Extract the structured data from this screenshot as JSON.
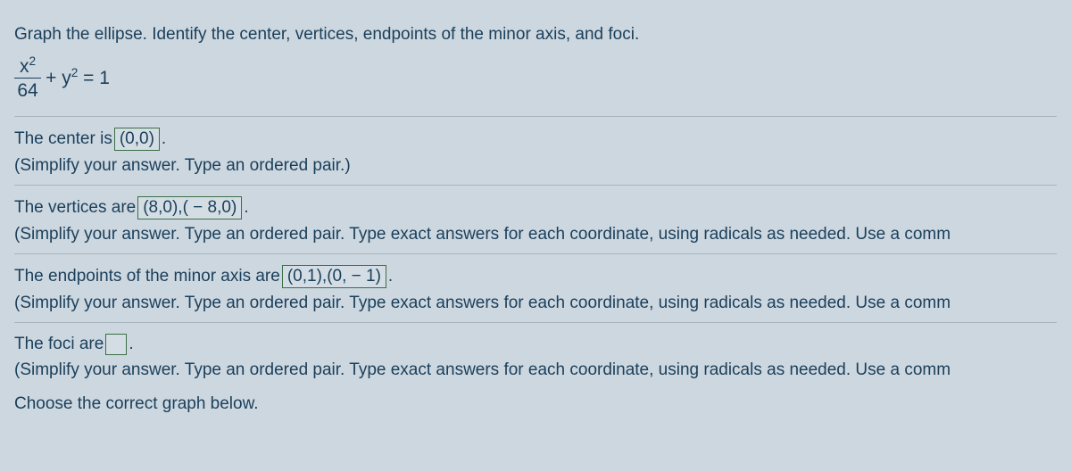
{
  "prompt": "Graph the ellipse. Identify the center, vertices, endpoints of the minor axis, and foci.",
  "equation": {
    "num": "x",
    "numExp": "2",
    "den": "64",
    "plus": "+ y",
    "yExp": "2",
    "eq": " = 1"
  },
  "center": {
    "label_pre": "The center is ",
    "value": "(0,0)",
    "period": ".",
    "instr": "(Simplify your answer. Type an ordered pair.)"
  },
  "vertices": {
    "label_pre": "The vertices are ",
    "value": "(8,0),( − 8,0)",
    "period": ".",
    "instr": "(Simplify your answer. Type an ordered pair. Type exact answers for each coordinate, using radicals as needed. Use a comm"
  },
  "minor": {
    "label_pre": "The endpoints of the minor axis are ",
    "value": "(0,1),(0, − 1)",
    "period": ".",
    "instr": "(Simplify your answer. Type an ordered pair. Type exact answers for each coordinate, using radicals as needed. Use a comm"
  },
  "foci": {
    "label_pre": "The foci are ",
    "value": "",
    "period": ".",
    "instr": "(Simplify your answer. Type an ordered pair. Type exact answers for each coordinate, using radicals as needed. Use a comm"
  },
  "graph_prompt": "Choose the correct graph below."
}
